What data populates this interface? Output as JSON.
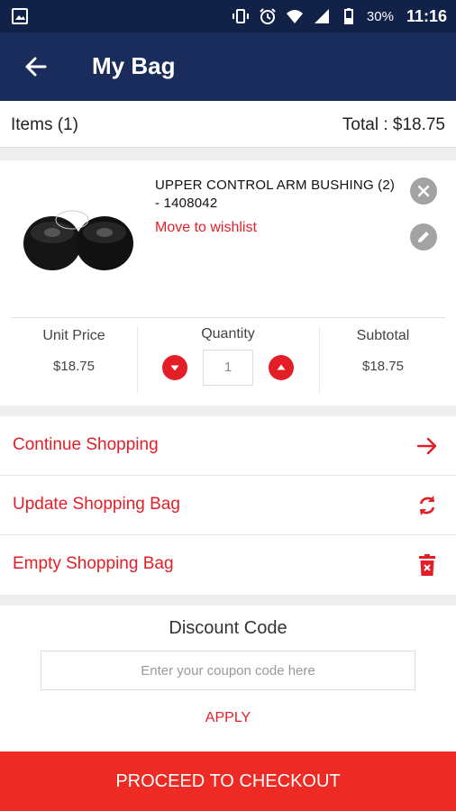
{
  "status_bar": {
    "battery": "30%",
    "time": "11:16",
    "icons": [
      "image-icon",
      "vibrate-icon",
      "alarm-icon",
      "wifi-icon",
      "signal-icon",
      "battery-icon"
    ]
  },
  "app_bar": {
    "title": "My Bag",
    "back_icon": "arrow-left-icon"
  },
  "summary": {
    "items_label": "Items (1)",
    "total_label": "Total : $18.75"
  },
  "product": {
    "name": "UPPER CONTROL ARM BUSHING (2) - 1408042",
    "wishlist_label": "Move to wishlist",
    "unit_price_label": "Unit Price",
    "unit_price": "$18.75",
    "quantity_label": "Quantity",
    "quantity": "1",
    "subtotal_label": "Subtotal",
    "subtotal": "$18.75"
  },
  "actions": [
    {
      "label": "Continue Shopping",
      "icon": "arrow-right-icon"
    },
    {
      "label": "Update Shopping Bag",
      "icon": "refresh-icon"
    },
    {
      "label": "Empty Shopping Bag",
      "icon": "trash-icon"
    }
  ],
  "discount": {
    "title": "Discount Code",
    "placeholder": "Enter your coupon code here",
    "apply_label": "APPLY"
  },
  "checkout_label": "PROCEED TO CHECKOUT",
  "colors": {
    "status_bar": "#112147",
    "app_bar": "#1a2c5b",
    "accent_red": "#e41e26",
    "checkout_red": "#ee2a24"
  }
}
